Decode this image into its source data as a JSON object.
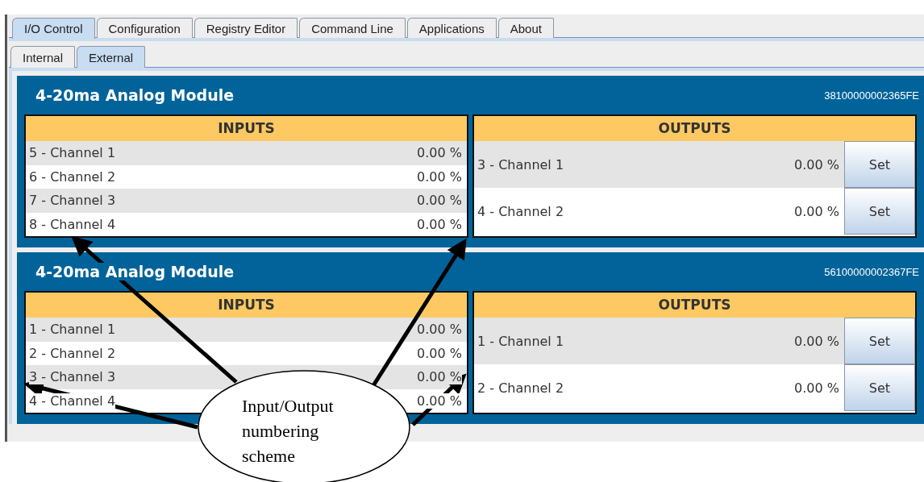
{
  "tabs": [
    {
      "label": "I/O Control",
      "selected": true
    },
    {
      "label": "Configuration",
      "selected": false
    },
    {
      "label": "Registry Editor",
      "selected": false
    },
    {
      "label": "Command Line",
      "selected": false
    },
    {
      "label": "Applications",
      "selected": false
    },
    {
      "label": "About",
      "selected": false
    }
  ],
  "subtabs": [
    {
      "label": "Internal",
      "selected": false
    },
    {
      "label": "External",
      "selected": true
    }
  ],
  "modules": [
    {
      "title": "4-20ma Analog Module",
      "serial": "38100000002365FE",
      "inputs": {
        "heading": "INPUTS",
        "rows": [
          {
            "label": "5 - Channel 1",
            "value": "0.00 %"
          },
          {
            "label": "6 - Channel 2",
            "value": "0.00 %"
          },
          {
            "label": "7 - Channel 3",
            "value": "0.00 %"
          },
          {
            "label": "8 - Channel 4",
            "value": "0.00 %"
          }
        ]
      },
      "outputs": {
        "heading": "OUTPUTS",
        "rows": [
          {
            "label": "3 - Channel 1",
            "value": "0.00 %",
            "button": "Set"
          },
          {
            "label": "4 - Channel 2",
            "value": "0.00 %",
            "button": "Set"
          }
        ]
      }
    },
    {
      "title": "4-20ma Analog Module",
      "serial": "56100000002367FE",
      "inputs": {
        "heading": "INPUTS",
        "rows": [
          {
            "label": "1 - Channel 1",
            "value": "0.00 %"
          },
          {
            "label": "2 - Channel 2",
            "value": "0.00 %"
          },
          {
            "label": "3 - Channel 3",
            "value": "0.00 %"
          },
          {
            "label": "4 - Channel 4",
            "value": "0.00 %"
          }
        ]
      },
      "outputs": {
        "heading": "OUTPUTS",
        "rows": [
          {
            "label": "1 - Channel 1",
            "value": "0.00 %",
            "button": "Set"
          },
          {
            "label": "2 - Channel 2",
            "value": "0.00 %",
            "button": "Set"
          }
        ]
      }
    }
  ],
  "callout": {
    "text": "Input/Output numbering scheme"
  }
}
